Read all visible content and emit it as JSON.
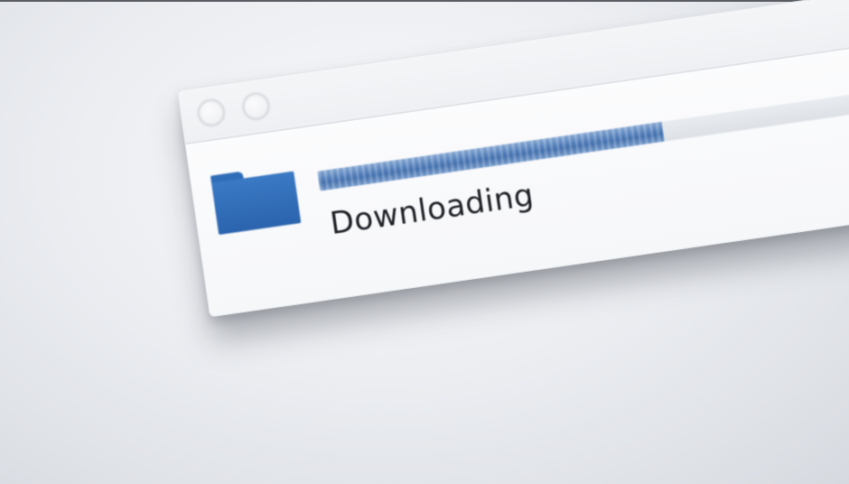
{
  "window": {
    "title_buttons": [
      "close",
      "minimize"
    ],
    "icon": "folder-icon",
    "icon_color": "#2f6db8",
    "progress": {
      "fraction": 0.55,
      "fill_color": "#4f7cb8"
    },
    "status_text": "Downloading"
  }
}
